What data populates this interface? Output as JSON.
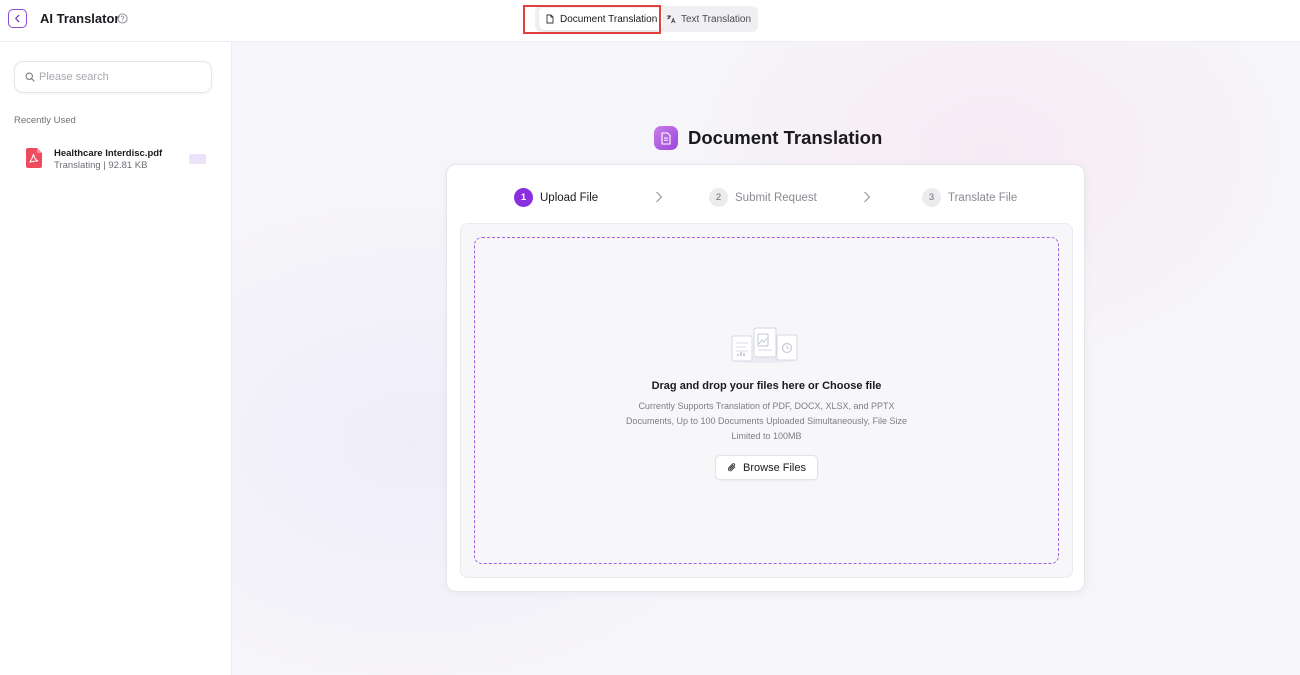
{
  "header": {
    "app_title": "AI Translator",
    "tabs": [
      {
        "label": "Document Translation",
        "active": true
      },
      {
        "label": "Text Translation",
        "active": false
      }
    ]
  },
  "sidebar": {
    "search_placeholder": "Please search",
    "section_label": "Recently Used",
    "recent_items": [
      {
        "name": "Healthcare Interdisc.pdf",
        "meta": "Translating | 92.81 KB"
      }
    ]
  },
  "main": {
    "heading": "Document Translation",
    "steps": [
      {
        "num": "1",
        "label": "Upload File",
        "active": true
      },
      {
        "num": "2",
        "label": "Submit Request",
        "active": false
      },
      {
        "num": "3",
        "label": "Translate File",
        "active": false
      }
    ],
    "dropzone": {
      "title": "Drag and drop your files here or Choose file",
      "description": "Currently Supports Translation of PDF, DOCX, XLSX, and PPTX Documents, Up to 100 Documents Uploaded Simultaneously, File Size Limited to 100MB",
      "browse_label": "Browse Files"
    }
  },
  "colors": {
    "accent": "#8a2ee0",
    "highlight_box": "#e0413a",
    "pdf_icon": "#ef4b5f"
  },
  "icons": [
    "back-arrow-icon",
    "help-icon",
    "document-icon",
    "text-translate-icon",
    "search-icon",
    "pdf-file-icon",
    "chevron-right-icon",
    "files-illustration-icon",
    "paperclip-icon"
  ]
}
